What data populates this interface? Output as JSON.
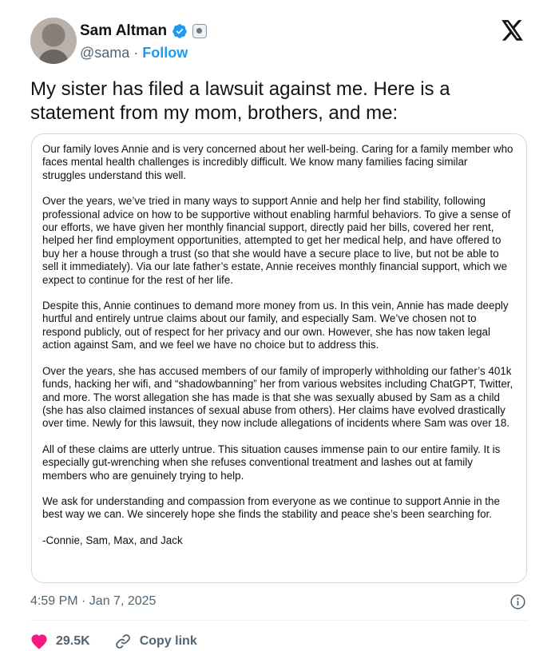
{
  "author": {
    "name": "Sam Altman",
    "handle": "@sama",
    "separator": "·",
    "follow_label": "Follow",
    "verified_color": "#1d9bf0"
  },
  "tweet": {
    "text": "My sister has filed a lawsuit against me. Here is a statement from my mom, brothers, and me:"
  },
  "statement": {
    "paragraphs": [
      "Our family loves Annie and is very concerned about her well-being. Caring for a family member who faces mental health challenges is incredibly difficult. We know many families facing similar struggles understand this well.",
      "Over the years, we’ve tried in many ways to support Annie and help her find stability, following professional advice on how to be supportive without enabling harmful behaviors. To give a sense of our efforts, we have given her monthly financial support, directly paid her bills, covered her rent, helped her find employment opportunities, attempted to get her medical help, and have offered to buy her a house through a trust (so that she would have a secure place to live, but not be able to sell it immediately). Via our late father’s estate, Annie receives monthly financial support, which we expect to continue for the rest of her life.",
      "Despite this, Annie continues to demand more money from us. In this vein, Annie has made deeply hurtful and entirely untrue claims about our family, and especially Sam. We’ve chosen not to respond publicly, out of respect for her privacy and our own. However, she has now taken legal action against Sam, and we feel we have no choice but to address this.",
      "Over the years, she has accused members of our family of improperly withholding our father’s 401k funds, hacking her wifi, and “shadowbanning” her from various websites including ChatGPT, Twitter, and more. The worst allegation she has made is that she was sexually abused by Sam as a child (she has also claimed instances of sexual abuse from others). Her claims have evolved drastically over time. Newly for this lawsuit, they now include allegations of incidents where Sam was over 18.",
      "All of these claims are utterly untrue. This situation causes immense pain to our entire family. It is especially gut-wrenching when she refuses conventional treatment and lashes out at family members who are genuinely trying to help.",
      "We ask for understanding and compassion from everyone as we continue to support Annie in the best way we can. We sincerely hope she finds the stability and peace she’s been searching for.",
      "-Connie, Sam, Max, and Jack"
    ]
  },
  "meta": {
    "timestamp": "4:59 PM · Jan 7, 2025"
  },
  "actions": {
    "likes": "29.5K",
    "copy_link_label": "Copy link",
    "like_color": "#f91880"
  },
  "icons": [
    "verified-icon",
    "gray-badge-icon",
    "x-logo-icon",
    "info-icon",
    "heart-icon",
    "link-icon"
  ]
}
